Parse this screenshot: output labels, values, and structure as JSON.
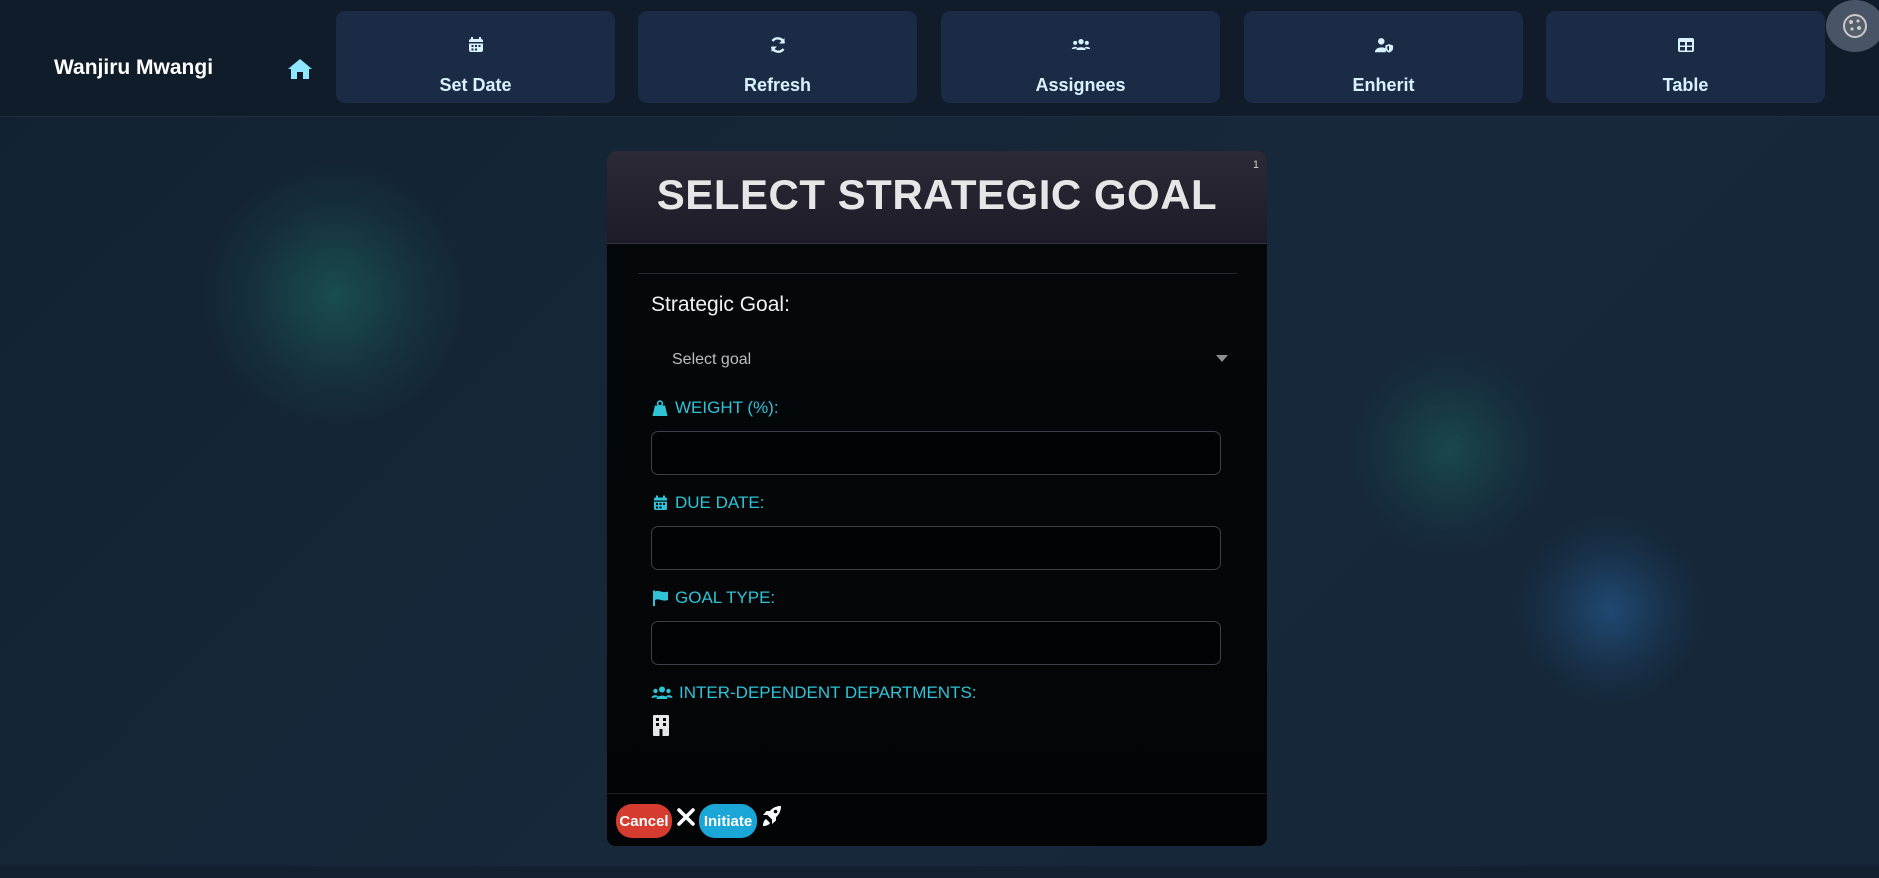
{
  "topbar": {
    "brand": "Wanjiru Mwangi",
    "home_icon": "home-icon",
    "nav": [
      {
        "label": "Set Date",
        "icon": "calendar-icon"
      },
      {
        "label": "Refresh",
        "icon": "refresh-icon"
      },
      {
        "label": "Assignees",
        "icon": "users-icon"
      },
      {
        "label": "Enherit",
        "icon": "user-shield-icon"
      },
      {
        "label": "Table",
        "icon": "table-icon"
      }
    ],
    "corner_icon": "cookie-icon"
  },
  "modal": {
    "title": "SELECT STRATEGIC GOAL",
    "badge": "1",
    "strategic_goal_label": "Strategic Goal:",
    "strategic_goal_select": {
      "value": "Select goal"
    },
    "weight_label": "WEIGHT (%):",
    "weight_value": "",
    "due_date_label": "DUE DATE:",
    "due_date_value": "",
    "goal_type_label": "GOAL TYPE:",
    "goal_type_value": "",
    "departments_label": "INTER-DEPENDENT DEPARTMENTS:",
    "cancel_label": "Cancel",
    "initiate_label": "Initiate"
  },
  "colors": {
    "accent": "#2ec4d6",
    "cancel": "#d63b2f",
    "initiate": "#1aa6d6",
    "nav_button": "#1b2a45",
    "background": "#14202e"
  }
}
